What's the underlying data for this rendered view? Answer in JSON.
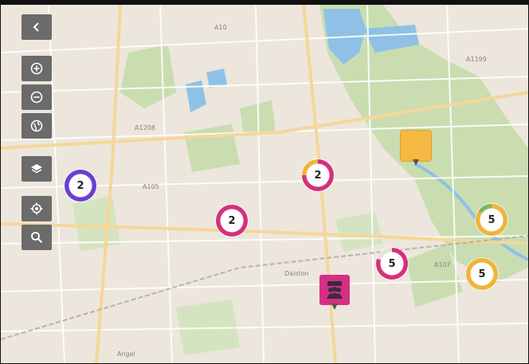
{
  "map": {
    "labels": [
      "Dalston",
      "Angel",
      "A1208",
      "A105",
      "A10",
      "A107",
      "A1199"
    ],
    "colors": {
      "land": "#ece6dc",
      "park": "#c9ddb0",
      "water": "#8fc1e6",
      "road_major": "#f4d79a",
      "road_minor": "#ffffff"
    }
  },
  "toolbar": {
    "buttons": [
      {
        "name": "collapse-button",
        "icon": "chevron-left-icon"
      },
      {
        "name": "zoom-in-button",
        "icon": "plus-circle-icon"
      },
      {
        "name": "zoom-out-button",
        "icon": "minus-circle-icon"
      },
      {
        "name": "globe-button",
        "icon": "globe-icon"
      },
      {
        "name": "layers-button",
        "icon": "layers-icon"
      },
      {
        "name": "locate-button",
        "icon": "crosshair-icon"
      },
      {
        "name": "search-button",
        "icon": "search-icon"
      }
    ]
  },
  "clusters": [
    {
      "count": "2",
      "ring": [
        "#6a3fd1"
      ],
      "fraction": 1.0
    },
    {
      "count": "2",
      "ring": [
        "#d4307c",
        "#f0b43a"
      ],
      "fraction": 0.75
    },
    {
      "count": "2",
      "ring": [
        "#d4307c"
      ],
      "fraction": 1.0
    },
    {
      "count": "5",
      "ring": [
        "#d4307c"
      ],
      "fraction": 0.8
    },
    {
      "count": "5",
      "ring": [
        "#f0b43a",
        "#7ab85a"
      ],
      "fraction": 0.85
    },
    {
      "count": "5",
      "ring": [
        "#f0b43a"
      ],
      "fraction": 1.0
    }
  ],
  "pins": [
    {
      "name": "yellow-marker",
      "color": "#f5b942",
      "icon": ""
    },
    {
      "name": "pink-marker",
      "color": "#d42f86",
      "icon": "people-group-icon"
    }
  ]
}
